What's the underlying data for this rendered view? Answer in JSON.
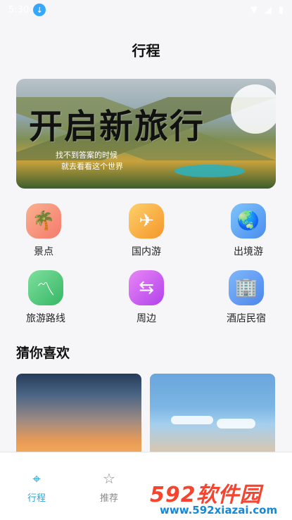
{
  "status": {
    "time": "5:30",
    "download_icon": "download-icon",
    "wifi_icon": "wifi-icon",
    "signal_icon": "signal-icon",
    "battery_icon": "battery-icon"
  },
  "header": {
    "title": "行程"
  },
  "banner": {
    "headline": "开启新旅行",
    "line1": "找不到答案的时候",
    "line2": "就去看看这个世界"
  },
  "categories": [
    {
      "label": "景点",
      "icon": "palm-tree-icon",
      "color": "#f88b7a"
    },
    {
      "label": "国内游",
      "icon": "paper-plane-icon",
      "color": "#f8ae3b"
    },
    {
      "label": "出境游",
      "icon": "globe-icon",
      "color": "#5ba5f5"
    },
    {
      "label": "旅游路线",
      "icon": "route-icon",
      "color": "#4fc97a"
    },
    {
      "label": "周边",
      "icon": "signpost-icon",
      "color": "#c55cf0"
    },
    {
      "label": "酒店民宿",
      "icon": "building-icon",
      "color": "#5f9bf3"
    }
  ],
  "section": {
    "title": "猜你喜欢"
  },
  "nav": {
    "items": [
      {
        "label": "行程",
        "icon": "location-pin-icon",
        "active": true
      },
      {
        "label": "推荐",
        "icon": "bookmark-star-icon",
        "active": false
      }
    ],
    "active_color": "#2aa6d9",
    "inactive_color": "#8a8a8a"
  },
  "watermark": {
    "main": "592软件园",
    "sub": "www.592xiazai.com"
  }
}
